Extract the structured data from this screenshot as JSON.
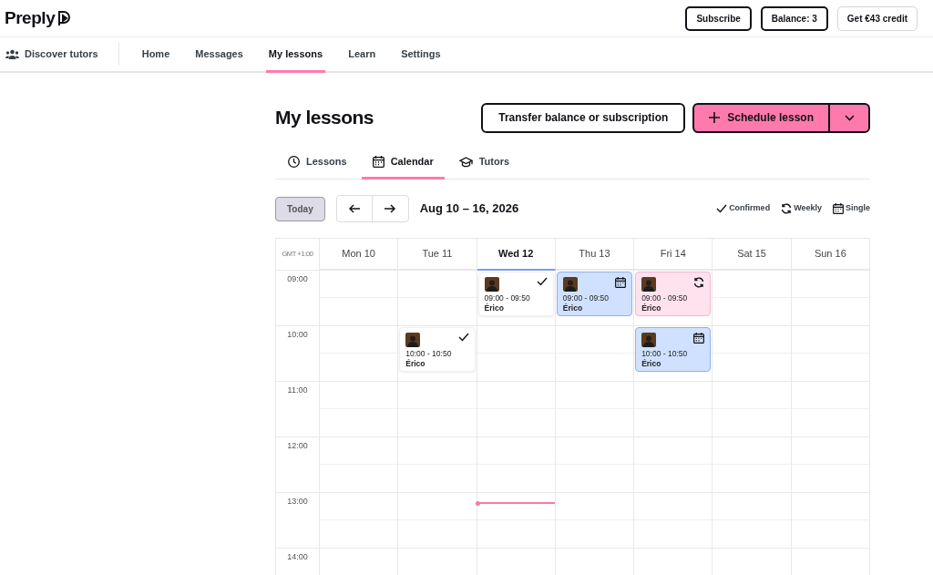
{
  "brand": "Preply",
  "header_buttons": [
    {
      "label": "Subscribe",
      "kind": "outline"
    },
    {
      "label": "Balance: 3",
      "kind": "outline"
    },
    {
      "label": "Get €43 credit",
      "kind": "light"
    }
  ],
  "nav": {
    "discover": "Discover tutors",
    "items": [
      {
        "label": "Home",
        "selected": false
      },
      {
        "label": "Messages",
        "selected": false
      },
      {
        "label": "My lessons",
        "selected": true
      },
      {
        "label": "Learn",
        "selected": false
      },
      {
        "label": "Settings",
        "selected": false
      }
    ]
  },
  "page_title": "My lessons",
  "actions": {
    "transfer": "Transfer balance or subscription",
    "schedule": "Schedule lesson"
  },
  "tabs": [
    {
      "label": "Lessons",
      "kind": "clock",
      "selected": false
    },
    {
      "label": "Calendar",
      "kind": "calendar",
      "selected": true
    },
    {
      "label": "Tutors",
      "kind": "cap",
      "selected": false
    }
  ],
  "toolbar": {
    "today": "Today",
    "range": "Aug 10 – 16, 2026",
    "legend": [
      {
        "kind": "confirmed",
        "label": "Confirmed"
      },
      {
        "kind": "weekly",
        "label": "Weekly"
      },
      {
        "kind": "single",
        "label": "Single"
      }
    ]
  },
  "calendar": {
    "timezone": "GMT +1:00",
    "days": [
      {
        "label": "Mon 10",
        "selected": false
      },
      {
        "label": "Tue 11",
        "selected": false
      },
      {
        "label": "Wed 12",
        "selected": true
      },
      {
        "label": "Thu 13",
        "selected": false
      },
      {
        "label": "Fri 14",
        "selected": false
      },
      {
        "label": "Sat 15",
        "selected": false
      },
      {
        "label": "Sun 16",
        "selected": false
      }
    ],
    "rows": [
      {
        "label": "09:00",
        "cells": [
          {
            "kind": "empty"
          },
          {
            "kind": "empty"
          },
          {
            "kind": "confirmed",
            "time": "09:00 - 09:50",
            "tutor": "Érico"
          },
          {
            "kind": "single",
            "time": "09:00 - 09:50",
            "tutor": "Érico"
          },
          {
            "kind": "weekly",
            "time": "09:00 - 09:50",
            "tutor": "Érico"
          },
          {
            "kind": "empty"
          },
          {
            "kind": "empty"
          }
        ]
      },
      {
        "label": "10:00",
        "cells": [
          {
            "kind": "empty"
          },
          {
            "kind": "confirmed",
            "time": "10:00 - 10:50",
            "tutor": "Érico"
          },
          {
            "kind": "empty"
          },
          {
            "kind": "empty"
          },
          {
            "kind": "single",
            "time": "10:00 - 10:50",
            "tutor": "Érico"
          },
          {
            "kind": "empty"
          },
          {
            "kind": "empty"
          }
        ]
      },
      {
        "label": "11:00",
        "cells": [
          {
            "kind": "empty"
          },
          {
            "kind": "empty"
          },
          {
            "kind": "empty"
          },
          {
            "kind": "empty"
          },
          {
            "kind": "empty"
          },
          {
            "kind": "empty"
          },
          {
            "kind": "empty"
          }
        ]
      },
      {
        "label": "12:00",
        "cells": [
          {
            "kind": "empty"
          },
          {
            "kind": "empty"
          },
          {
            "kind": "empty"
          },
          {
            "kind": "empty"
          },
          {
            "kind": "empty"
          },
          {
            "kind": "empty"
          },
          {
            "kind": "empty"
          }
        ]
      },
      {
        "label": "13:00",
        "cells": [
          {
            "kind": "empty"
          },
          {
            "kind": "empty"
          },
          {
            "kind": "now"
          },
          {
            "kind": "empty"
          },
          {
            "kind": "empty"
          },
          {
            "kind": "empty"
          },
          {
            "kind": "empty"
          }
        ]
      },
      {
        "label": "14:00",
        "cells": [
          {
            "kind": "empty"
          },
          {
            "kind": "empty"
          },
          {
            "kind": "empty"
          },
          {
            "kind": "empty"
          },
          {
            "kind": "empty"
          },
          {
            "kind": "empty"
          },
          {
            "kind": "empty"
          }
        ]
      }
    ]
  }
}
